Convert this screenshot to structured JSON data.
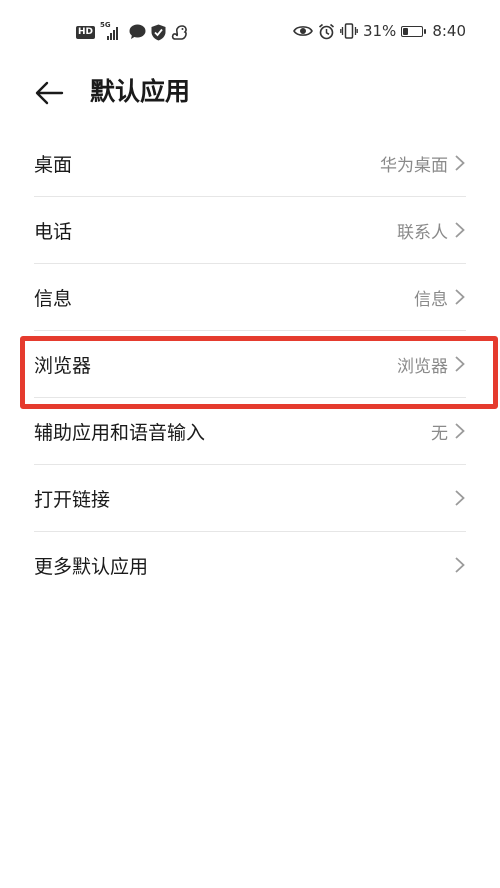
{
  "status_bar": {
    "left_badge": "HD",
    "network": "5G",
    "eye": "eye-icon",
    "alarm": "alarm-icon",
    "battery_percent": "31%",
    "battery_level": 0.31,
    "time": "8:40"
  },
  "header": {
    "title": "默认应用"
  },
  "items": [
    {
      "label": "桌面",
      "value": "华为桌面"
    },
    {
      "label": "电话",
      "value": "联系人"
    },
    {
      "label": "信息",
      "value": "信息"
    },
    {
      "label": "浏览器",
      "value": "浏览器"
    },
    {
      "label": "辅助应用和语音输入",
      "value": "无"
    },
    {
      "label": "打开链接",
      "value": ""
    },
    {
      "label": "更多默认应用",
      "value": ""
    }
  ],
  "highlight_color": "#e53b2e"
}
